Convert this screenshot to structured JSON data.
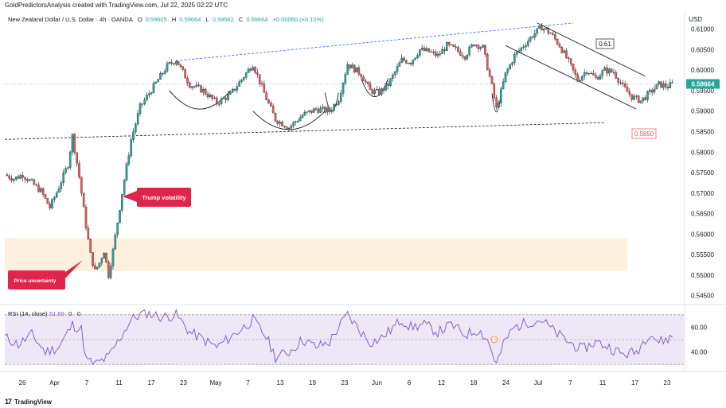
{
  "header": {
    "attribution": "GoldPredictorsAnalysis created with TradingView.com, Jul 22, 2025 02:22 UTC"
  },
  "symbol": {
    "name": "New Zealand Dollar / U.S. Dollar · 4h · OANDA",
    "open_label": "O",
    "open": "0.59605",
    "high_label": "H",
    "high": "0.59664",
    "low_label": "L",
    "low": "0.59562",
    "close_label": "C",
    "close": "0.59664",
    "change": "+0.00060 (+0.10%)"
  },
  "currency_label": "USD",
  "rsi": {
    "label": "RSI (14, close)",
    "value": "51.89",
    "extra1": "0",
    "extra2": "0",
    "ticks": [
      "60.00",
      "40.00"
    ]
  },
  "annotations": {
    "trump": "Trump volatility",
    "price_uncertainty": "Price uncertainty",
    "upper_trendline_label": "0.61",
    "lower_trendline_label": "0.5850",
    "last_price": "0.59664"
  },
  "footer": {
    "brand": "TradingView",
    "logo": "17"
  },
  "colors": {
    "up": "#26a69a",
    "down": "#ef5350",
    "wick": "#131722",
    "rsi_line": "#7e57c2",
    "rsi_band": "#ede7f6",
    "supply_zone": "#fdf0dc",
    "callout": "#e0244a",
    "trendline_blue": "#2962ff",
    "last_price": "#26a69a"
  },
  "chart_data": {
    "type": "candlestick",
    "y_axis": {
      "min": 0.543,
      "max": 0.614,
      "ticks": [
        "0.61000",
        "0.60500",
        "0.60000",
        "0.59500",
        "0.59000",
        "0.58500",
        "0.58000",
        "0.57500",
        "0.57000",
        "0.56500",
        "0.56000",
        "0.55500",
        "0.55000",
        "0.54500"
      ]
    },
    "x_ticks": [
      "26",
      "Apr",
      "7",
      "11",
      "17",
      "23",
      "May",
      "7",
      "13",
      "19",
      "23",
      "Jun",
      "6",
      "12",
      "18",
      "24",
      "Jul",
      "7",
      "11",
      "17",
      "23"
    ],
    "price_path": [
      [
        0,
        0.5745
      ],
      [
        4,
        0.5735
      ],
      [
        8,
        0.5745
      ],
      [
        12,
        0.5725
      ],
      [
        16,
        0.5705
      ],
      [
        20,
        0.5665
      ],
      [
        24,
        0.5715
      ],
      [
        28,
        0.577
      ],
      [
        30,
        0.584
      ],
      [
        33,
        0.574
      ],
      [
        36,
        0.562
      ],
      [
        38,
        0.555
      ],
      [
        40,
        0.551
      ],
      [
        42,
        0.553
      ],
      [
        44,
        0.556
      ],
      [
        46,
        0.55
      ],
      [
        48,
        0.556
      ],
      [
        52,
        0.57
      ],
      [
        56,
        0.583
      ],
      [
        60,
        0.591
      ],
      [
        66,
        0.596
      ],
      [
        72,
        0.601
      ],
      [
        76,
        0.6025
      ],
      [
        82,
        0.5965
      ],
      [
        88,
        0.595
      ],
      [
        94,
        0.592
      ],
      [
        100,
        0.594
      ],
      [
        106,
        0.5985
      ],
      [
        110,
        0.6015
      ],
      [
        116,
        0.593
      ],
      [
        120,
        0.588
      ],
      [
        126,
        0.586
      ],
      [
        132,
        0.589
      ],
      [
        138,
        0.5905
      ],
      [
        144,
        0.59
      ],
      [
        148,
        0.593
      ],
      [
        152,
        0.6015
      ],
      [
        158,
        0.599
      ],
      [
        162,
        0.595
      ],
      [
        166,
        0.5945
      ],
      [
        170,
        0.5965
      ],
      [
        176,
        0.6025
      ],
      [
        180,
        0.602
      ],
      [
        184,
        0.605
      ],
      [
        188,
        0.6045
      ],
      [
        192,
        0.6035
      ],
      [
        196,
        0.606
      ],
      [
        200,
        0.605
      ],
      [
        204,
        0.6035
      ],
      [
        208,
        0.6065
      ],
      [
        212,
        0.6055
      ],
      [
        216,
        0.596
      ],
      [
        218,
        0.5905
      ],
      [
        222,
        0.599
      ],
      [
        226,
        0.6035
      ],
      [
        230,
        0.606
      ],
      [
        234,
        0.6085
      ],
      [
        238,
        0.6105
      ],
      [
        242,
        0.609
      ],
      [
        246,
        0.606
      ],
      [
        250,
        0.602
      ],
      [
        254,
        0.5975
      ],
      [
        258,
        0.6
      ],
      [
        262,
        0.598
      ],
      [
        266,
        0.6
      ],
      [
        270,
        0.5995
      ],
      [
        274,
        0.596
      ],
      [
        278,
        0.5935
      ],
      [
        282,
        0.5925
      ],
      [
        286,
        0.5945
      ],
      [
        290,
        0.5965
      ],
      [
        294,
        0.596
      ],
      [
        296,
        0.59664
      ]
    ],
    "rsi_bounds": {
      "min": 25,
      "max": 75,
      "upper": 70,
      "lower": 30
    },
    "rsi_path": [
      [
        0,
        52
      ],
      [
        6,
        46
      ],
      [
        12,
        54
      ],
      [
        18,
        40
      ],
      [
        24,
        44
      ],
      [
        30,
        62
      ],
      [
        34,
        58
      ],
      [
        36,
        34
      ],
      [
        40,
        30
      ],
      [
        46,
        36
      ],
      [
        50,
        48
      ],
      [
        56,
        66
      ],
      [
        62,
        72
      ],
      [
        70,
        68
      ],
      [
        76,
        70
      ],
      [
        82,
        56
      ],
      [
        88,
        50
      ],
      [
        94,
        44
      ],
      [
        100,
        52
      ],
      [
        106,
        60
      ],
      [
        110,
        66
      ],
      [
        116,
        52
      ],
      [
        120,
        36
      ],
      [
        126,
        40
      ],
      [
        132,
        50
      ],
      [
        138,
        44
      ],
      [
        144,
        48
      ],
      [
        148,
        60
      ],
      [
        152,
        70
      ],
      [
        158,
        56
      ],
      [
        162,
        48
      ],
      [
        166,
        50
      ],
      [
        170,
        56
      ],
      [
        176,
        66
      ],
      [
        180,
        60
      ],
      [
        186,
        62
      ],
      [
        192,
        56
      ],
      [
        198,
        62
      ],
      [
        204,
        54
      ],
      [
        210,
        58
      ],
      [
        214,
        50
      ],
      [
        218,
        30
      ],
      [
        222,
        50
      ],
      [
        226,
        60
      ],
      [
        232,
        64
      ],
      [
        238,
        66
      ],
      [
        244,
        56
      ],
      [
        250,
        48
      ],
      [
        256,
        42
      ],
      [
        262,
        48
      ],
      [
        268,
        44
      ],
      [
        274,
        38
      ],
      [
        280,
        40
      ],
      [
        286,
        56
      ],
      [
        290,
        48
      ],
      [
        296,
        52
      ]
    ]
  }
}
